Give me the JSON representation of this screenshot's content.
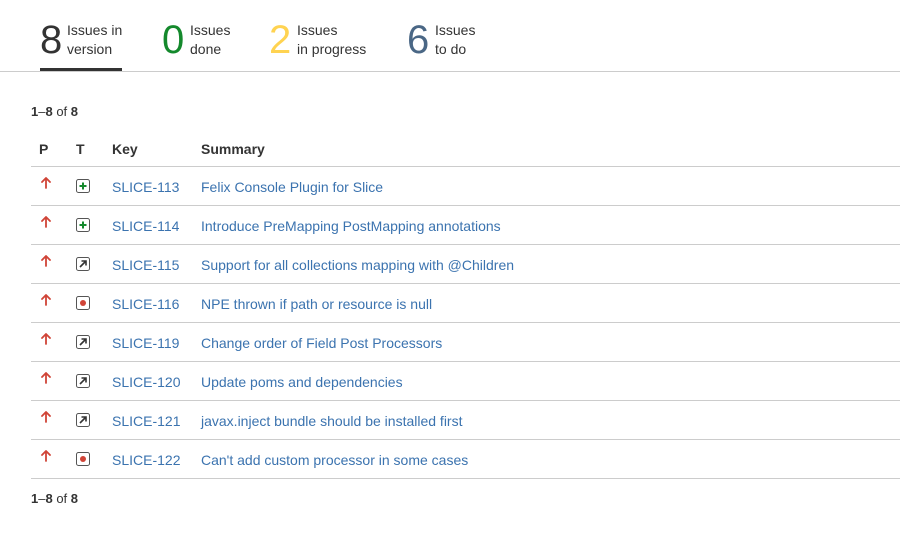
{
  "stats": [
    {
      "number": "8",
      "line1": "Issues in",
      "line2": "version",
      "color": "#333333"
    },
    {
      "number": "0",
      "line1": "Issues",
      "line2": "done",
      "color": "#14892c"
    },
    {
      "number": "2",
      "line1": "Issues",
      "line2": "in progress",
      "color": "#ffd351"
    },
    {
      "number": "6",
      "line1": "Issues",
      "line2": "to do",
      "color": "#4a6785"
    }
  ],
  "pagination": {
    "start": "1",
    "sep": "–",
    "end": "8",
    "of": " of ",
    "total": "8"
  },
  "columns": {
    "priority": "P",
    "type": "T",
    "key": "Key",
    "summary": "Summary"
  },
  "colors": {
    "link": "#3b73af",
    "priority_major": "#d04437",
    "type_feature": "#14892c",
    "type_improvement": "#333333",
    "type_bug": "#d04437"
  },
  "issues": [
    {
      "key": "SLICE-113",
      "summary": "Felix Console Plugin for Slice",
      "type_icon": "new-feature-icon",
      "priority_icon": "major-priority-icon"
    },
    {
      "key": "SLICE-114",
      "summary": "Introduce PreMapping PostMapping annotations",
      "type_icon": "new-feature-icon",
      "priority_icon": "major-priority-icon"
    },
    {
      "key": "SLICE-115",
      "summary": "Support for all collections mapping with @Children",
      "type_icon": "improvement-icon",
      "priority_icon": "major-priority-icon"
    },
    {
      "key": "SLICE-116",
      "summary": "NPE thrown if path or resource is null",
      "type_icon": "bug-icon",
      "priority_icon": "major-priority-icon"
    },
    {
      "key": "SLICE-119",
      "summary": "Change order of Field Post Processors",
      "type_icon": "improvement-icon",
      "priority_icon": "major-priority-icon"
    },
    {
      "key": "SLICE-120",
      "summary": "Update poms and dependencies",
      "type_icon": "improvement-icon",
      "priority_icon": "major-priority-icon"
    },
    {
      "key": "SLICE-121",
      "summary": "javax.inject bundle should be installed first",
      "type_icon": "improvement-icon",
      "priority_icon": "major-priority-icon"
    },
    {
      "key": "SLICE-122",
      "summary": "Can't add custom processor in some cases",
      "type_icon": "bug-icon",
      "priority_icon": "major-priority-icon"
    }
  ]
}
